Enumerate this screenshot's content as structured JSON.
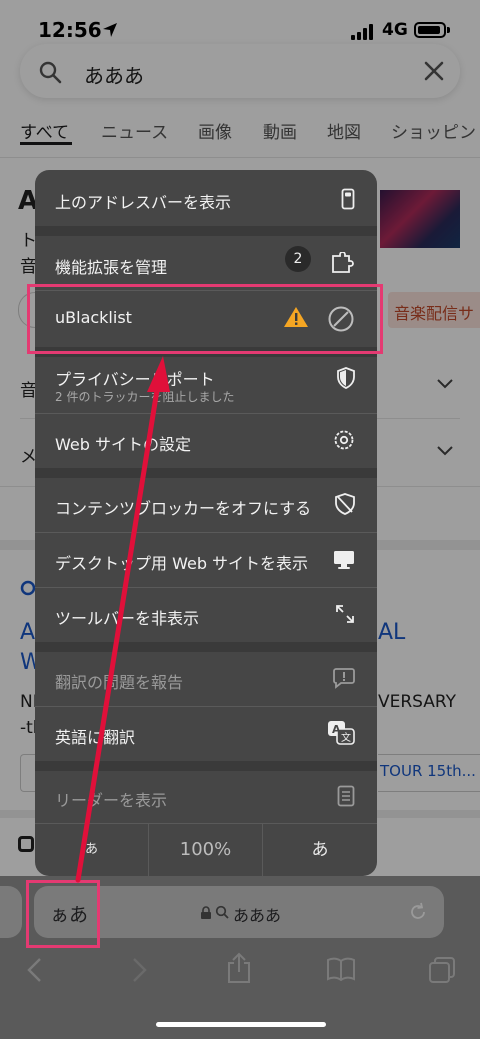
{
  "status": {
    "time": "12:56",
    "network": "4G"
  },
  "search": {
    "query": "あああ"
  },
  "tabs": [
    "すべて",
    "ニュース",
    "画像",
    "動画",
    "地図",
    "ショッピン"
  ],
  "background": {
    "title_initial": "A",
    "line1": "ト",
    "line2": "音",
    "row1": "音",
    "row2": "メ",
    "chip": "音楽配信サ",
    "link_left1": "A",
    "link_right1": "AL",
    "link_left2": "W",
    "snippet_left1": "NI",
    "snippet_right1": "VERSARY",
    "snippet_left2": "-th",
    "tour": "TOUR 15th..."
  },
  "menu": {
    "items": [
      {
        "label": "上のアドレスバーを表示",
        "icon": "phone-top-bar-icon"
      },
      {
        "label": "機能拡張を管理",
        "badge": "2",
        "icon": "extension-icon"
      },
      {
        "label": "uBlacklist",
        "icon": "block-icon",
        "warning_icon": "warning-icon"
      },
      {
        "label": "プライバシーレポート",
        "sublabel": "2 件のトラッカーを阻止しました",
        "icon": "privacy-shield-icon"
      },
      {
        "label": "Web サイトの設定",
        "icon": "gear-icon"
      },
      {
        "label": "コンテンツブロッカーをオフにする",
        "icon": "blocker-off-icon"
      },
      {
        "label": "デスクトップ用 Web サイトを表示",
        "icon": "desktop-icon"
      },
      {
        "label": "ツールバーを非表示",
        "icon": "expand-icon"
      },
      {
        "label": "翻訳の問題を報告",
        "icon": "report-icon",
        "disabled": true
      },
      {
        "label": "英語に翻訳",
        "icon": "translate-icon"
      },
      {
        "label": "リーダーを表示",
        "icon": "reader-icon",
        "disabled": true
      }
    ],
    "text_size": {
      "smaller": "あ",
      "zoom": "100%",
      "larger": "あ"
    }
  },
  "bottom": {
    "aa_label": "ぁあ",
    "url_text": "あああ"
  },
  "colors": {
    "highlight": "#e43a72",
    "warning": "#f5a623",
    "arrow": "#e0103a"
  }
}
